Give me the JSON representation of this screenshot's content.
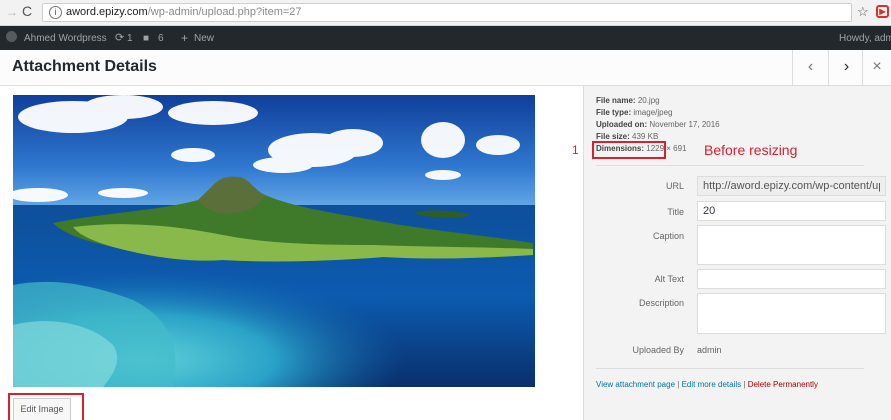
{
  "browser": {
    "url_host": "aword.epizy.com",
    "url_path": "/wp-admin/upload.php?item=27"
  },
  "adminbar": {
    "site_name": "Ahmed Wordpress",
    "updates_count": "1",
    "comments_count": "6",
    "new_label": "New",
    "howdy": "Howdy, admi"
  },
  "modal": {
    "title": "Attachment Details"
  },
  "edit_image_label": "Edit Image",
  "file_meta": {
    "file_name_label": "File name:",
    "file_name": "20.jpg",
    "file_type_label": "File type:",
    "file_type": "image/jpeg",
    "uploaded_on_label": "Uploaded on:",
    "uploaded_on": "November 17, 2016",
    "file_size_label": "File size:",
    "file_size": "439 KB",
    "dimensions_label": "Dimensions:",
    "dimensions": "1229 × 691"
  },
  "annotation": {
    "number": "1",
    "text": "Before resizing"
  },
  "fields": {
    "url_label": "URL",
    "url_value": "http://aword.epizy.com/wp-content/uploa",
    "title_label": "Title",
    "title_value": "20",
    "caption_label": "Caption",
    "alt_label": "Alt Text",
    "description_label": "Description",
    "uploaded_by_label": "Uploaded By",
    "uploaded_by_value": "admin"
  },
  "actions": {
    "view": "View attachment page",
    "edit_more": "Edit more details",
    "delete": "Delete Permanently",
    "separator": "|"
  }
}
